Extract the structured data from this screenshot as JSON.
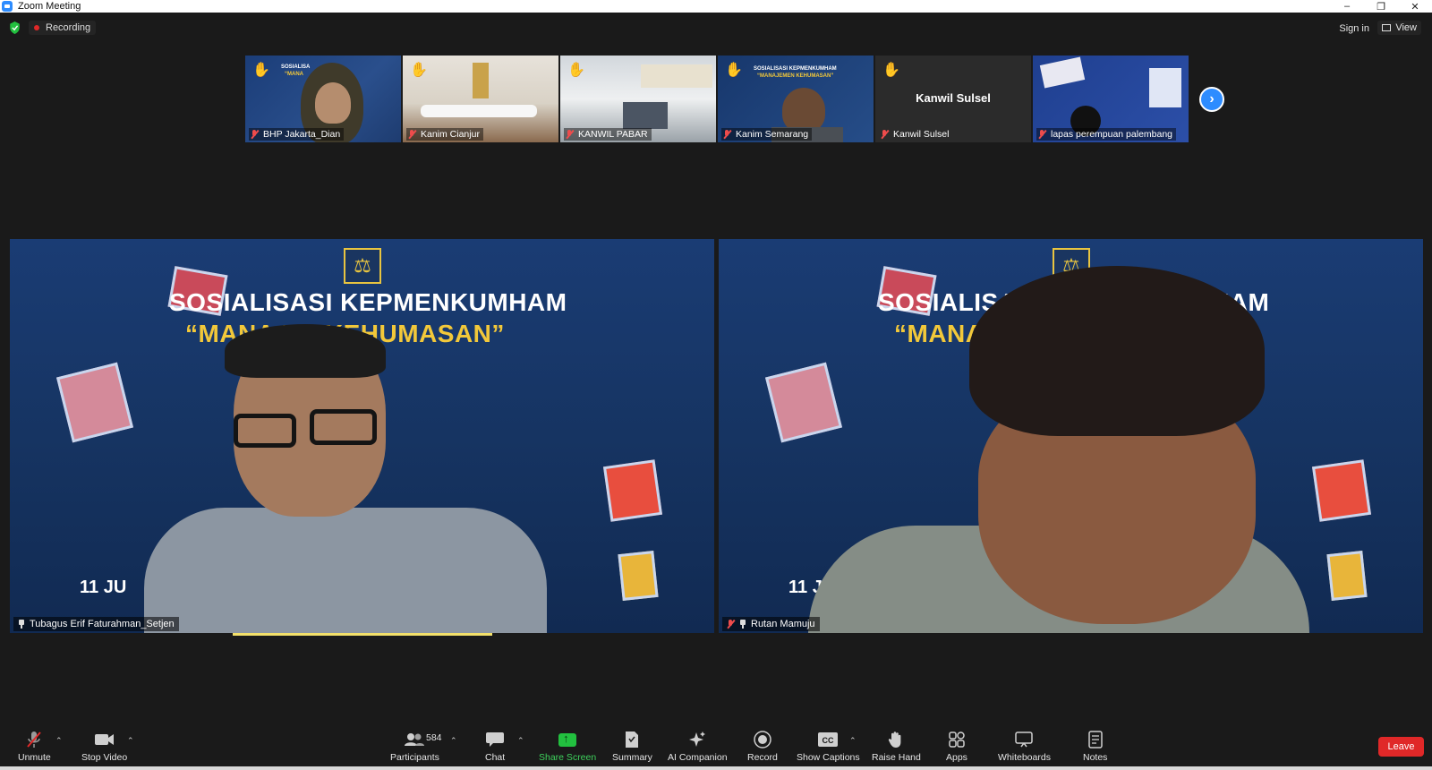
{
  "window": {
    "title": "Zoom Meeting",
    "minimize": "–",
    "restore": "❐",
    "close": "✕"
  },
  "topbar": {
    "recording": "Recording",
    "sign_in": "Sign in",
    "view": "View"
  },
  "thumbnails": [
    {
      "name": "BHP Jakarta_Dian",
      "muted": true,
      "hand_raised": true
    },
    {
      "name": "Kanim Cianjur",
      "muted": true,
      "hand_raised": true
    },
    {
      "name": "KANWIL PABAR",
      "muted": true,
      "hand_raised": true
    },
    {
      "name": "Kanim Semarang",
      "muted": true,
      "hand_raised": true
    },
    {
      "name": "Kanwil Sulsel",
      "muted": true,
      "hand_raised": true,
      "center_label": "Kanwil Sulsel"
    },
    {
      "name": "lapas perempuan palembang",
      "muted": true,
      "hand_raised": false
    }
  ],
  "thumb_text": {
    "t1": "SOSIALISA",
    "t1b": "“MANA",
    "t4": "SOSIALISASI KEPMENKUMHAM",
    "t4b": "“MANAJEMEN KEHUMASAN”"
  },
  "videos": [
    {
      "name": "Tubagus Erif Faturahman_Setjen",
      "heading1": "SOSIALISASI KEPMENKUMHAM",
      "heading2": "“MANA    EN KEHUMASAN”",
      "date": "11 JU"
    },
    {
      "name": "Rutan Mamuju",
      "heading1": "SOSIALISAS",
      "heading1b": "HAM",
      "heading2": "“MANA.",
      "date": "11 JUNI 202"
    }
  ],
  "toolbar": {
    "unmute": "Unmute",
    "stop_video": "Stop Video",
    "participants": "Participants",
    "participants_count": "584",
    "chat": "Chat",
    "share_screen": "Share Screen",
    "summary": "Summary",
    "ai_companion": "AI Companion",
    "record": "Record",
    "show_captions": "Show Captions",
    "raise_hand": "Raise Hand",
    "apps": "Apps",
    "whiteboards": "Whiteboards",
    "notes": "Notes",
    "leave": "Leave"
  },
  "colors": {
    "accent": "#2d8cff",
    "leave": "#e02828",
    "share": "#22c03f",
    "hand": "#f5c518",
    "speaker_bar": "#f3e06a"
  }
}
